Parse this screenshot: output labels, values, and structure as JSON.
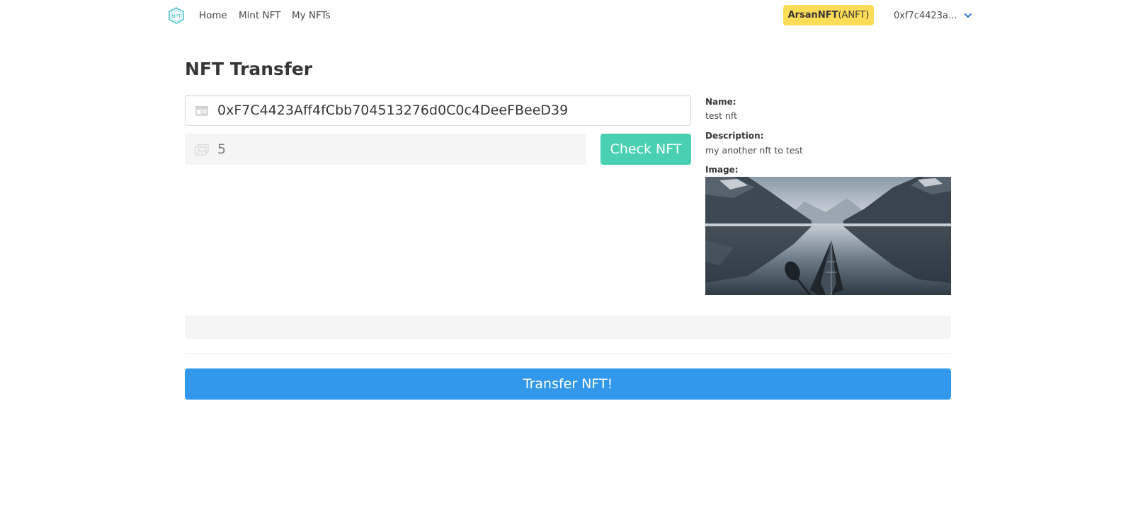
{
  "nav": {
    "logo_icon": "nft-hexagon-logo-icon",
    "links": [
      {
        "label": "Home"
      },
      {
        "label": "Mint NFT"
      },
      {
        "label": "My NFTs"
      }
    ],
    "token_name": "ArsanNFT",
    "token_symbol": "(ANFT)",
    "account": "0xf7c4423a...",
    "account_icon": "chevron-down-icon"
  },
  "page": {
    "title": "NFT Transfer"
  },
  "form": {
    "address_value": "0xF7C4423Aff4fCbb704513276d0C0c4DeeFBeeD39",
    "address_icon": "id-card-icon",
    "token_id_value": "5",
    "token_id_icon": "images-icon",
    "check_label": "Check NFT",
    "status_text": "",
    "transfer_label": "Transfer NFT!"
  },
  "details": {
    "name_label": "Name:",
    "name_value": "test nft",
    "description_label": "Description:",
    "description_value": "my another nft to test",
    "image_label": "Image:",
    "image_subject": "kayak-on-fjord-photo"
  },
  "colors": {
    "badge": "#ffdd57",
    "check_button": "#48d0b0",
    "transfer_button": "#3298eb",
    "logo": "#4fc3d0",
    "chevron": "#3273dc"
  }
}
